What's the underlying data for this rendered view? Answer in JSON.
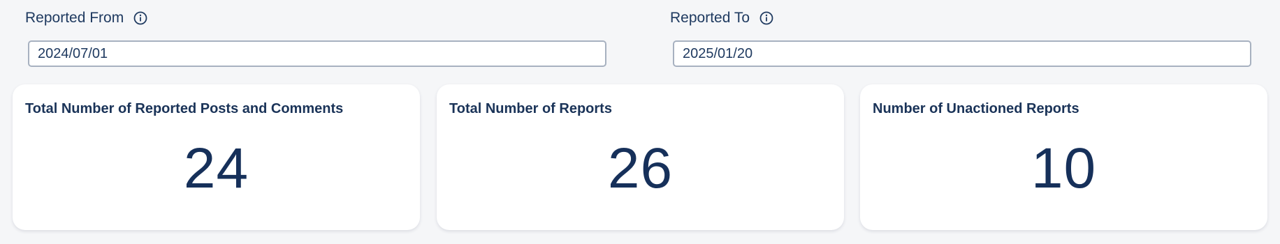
{
  "filters": {
    "from": {
      "label": "Reported From",
      "value": "2024/07/01",
      "icon": "info-icon"
    },
    "to": {
      "label": "Reported To",
      "value": "2025/01/20",
      "icon": "info-icon"
    }
  },
  "cards": [
    {
      "title": "Total Number of Reported Posts and Comments",
      "value": "24"
    },
    {
      "title": "Total Number of Reports",
      "value": "26"
    },
    {
      "title": "Number of Unactioned Reports",
      "value": "10"
    }
  ],
  "colors": {
    "background": "#f5f6f8",
    "text": "#1a3358",
    "input_border": "#a7b1c0",
    "card_background": "#ffffff"
  }
}
